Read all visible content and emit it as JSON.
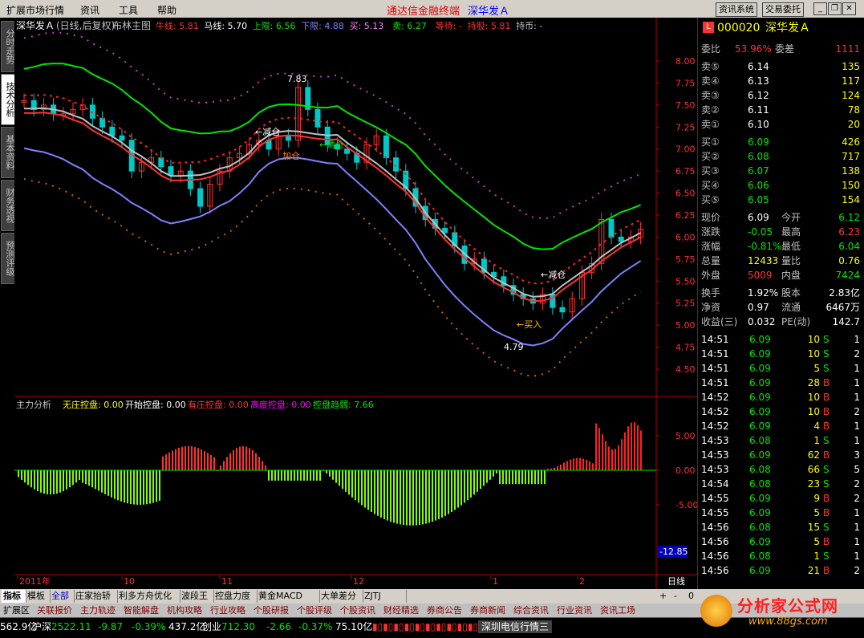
{
  "menu": {
    "items": [
      "扩展市场行情",
      "资讯",
      "工具",
      "帮助"
    ],
    "brand": "通达信金融终端",
    "brand_stock": "深华发Ａ",
    "buttons": [
      "资讯系统",
      "交易委托"
    ]
  },
  "left_tabs": [
    "分时走势",
    "技术分析",
    "基本资料",
    "财务透视",
    "预测评级"
  ],
  "main_chart": {
    "header_name": "深华发Ａ",
    "header_mode": "(日线,后复权)",
    "indicator": "布林主图",
    "labels": [
      {
        "t": "牛线: 5.81",
        "c": "#ff3232"
      },
      {
        "t": "马线: 5.70",
        "c": "#ffffff"
      },
      {
        "t": "上限: 6.56",
        "c": "#00e600"
      },
      {
        "t": "下限: 4.88",
        "c": "#8080ff"
      },
      {
        "t": "买: 5.13",
        "c": "#ff80ff"
      },
      {
        "t": "卖: 6.27",
        "c": "#00e600"
      },
      {
        "t": "等待: -",
        "c": "#ff3232"
      },
      {
        "t": "持股: 5.81",
        "c": "#ff3232"
      },
      {
        "t": "持币: -",
        "c": "#c0c0c0"
      }
    ],
    "price_ticks": [
      "8.00",
      "7.75",
      "7.50",
      "7.25",
      "7.00",
      "6.75",
      "6.50",
      "6.25",
      "6.00",
      "5.75",
      "5.50",
      "5.25",
      "5.00",
      "4.75",
      "4.50"
    ],
    "annotations": [
      {
        "t": "7.83",
        "c": "#ffffff"
      },
      {
        "t": "←减仓",
        "c": "#ffffff"
      },
      {
        "t": "加仓",
        "c": "#ff8000"
      },
      {
        "t": "←清仓",
        "c": "#00e600"
      },
      {
        "t": "←减仓",
        "c": "#ffffff"
      },
      {
        "t": "←买入",
        "c": "#ffc000"
      },
      {
        "t": "4.79",
        "c": "#ffffff"
      }
    ]
  },
  "sub_chart": {
    "indicator": "主力分析",
    "labels": [
      {
        "t": "无庄控盘: 0.00",
        "c": "#ffff00"
      },
      {
        "t": "开始控盘: 0.00",
        "c": "#ffffff"
      },
      {
        "t": "有庄控盘: 0.00",
        "c": "#ff3232"
      },
      {
        "t": "高度控盘: 0.00",
        "c": "#ff00ff"
      },
      {
        "t": "控盘趋弱: 7.66",
        "c": "#00e600"
      }
    ],
    "ticks": [
      "5.00",
      "0.00",
      "-5.00"
    ],
    "cursor_value": "-12.85"
  },
  "time_axis": {
    "labels": [
      "2011年",
      "10",
      "11",
      "12",
      "1",
      "2"
    ],
    "period": "日线"
  },
  "quote": {
    "code": "000020",
    "name": "深华发Ａ",
    "weibi_label": "委比",
    "weibi": "53.96%",
    "weicha_label": "委差",
    "weicha": "1111",
    "asks": [
      [
        "卖⑤",
        "6.14",
        "135"
      ],
      [
        "卖④",
        "6.13",
        "117"
      ],
      [
        "卖③",
        "6.12",
        "124"
      ],
      [
        "卖②",
        "6.11",
        "78"
      ],
      [
        "卖①",
        "6.10",
        "20"
      ]
    ],
    "bids": [
      [
        "买①",
        "6.09",
        "426"
      ],
      [
        "买②",
        "6.08",
        "717"
      ],
      [
        "买③",
        "6.07",
        "138"
      ],
      [
        "买④",
        "6.06",
        "150"
      ],
      [
        "买⑤",
        "6.05",
        "154"
      ]
    ],
    "stats": [
      [
        "现价",
        "6.09",
        "今开",
        "6.12"
      ],
      [
        "涨跌",
        "-0.05",
        "最高",
        "6.23"
      ],
      [
        "涨幅",
        "-0.81%",
        "最低",
        "6.04"
      ],
      [
        "总量",
        "12433",
        "量比",
        "0.76"
      ],
      [
        "外盘",
        "5009",
        "内盘",
        "7424"
      ]
    ],
    "stats2": [
      [
        "换手",
        "1.92%",
        "股本",
        "2.83亿"
      ],
      [
        "净资",
        "0.97",
        "流通",
        "6467万"
      ],
      [
        "收益(三)",
        "0.032",
        "PE(动)",
        "142.7"
      ]
    ],
    "ticks": [
      [
        "14:51",
        "6.09",
        "10",
        "S",
        "1"
      ],
      [
        "14:51",
        "6.09",
        "10",
        "S",
        "2"
      ],
      [
        "14:51",
        "6.09",
        "5",
        "S",
        "1"
      ],
      [
        "14:51",
        "6.09",
        "28",
        "B",
        "1"
      ],
      [
        "14:52",
        "6.09",
        "10",
        "B",
        "1"
      ],
      [
        "14:52",
        "6.09",
        "10",
        "B",
        "2"
      ],
      [
        "14:52",
        "6.09",
        "4",
        "B",
        "1"
      ],
      [
        "14:53",
        "6.08",
        "1",
        "S",
        "1"
      ],
      [
        "14:53",
        "6.09",
        "62",
        "B",
        "3"
      ],
      [
        "14:53",
        "6.08",
        "66",
        "S",
        "5"
      ],
      [
        "14:54",
        "6.08",
        "23",
        "S",
        "2"
      ],
      [
        "14:55",
        "6.09",
        "9",
        "B",
        "2"
      ],
      [
        "14:55",
        "6.09",
        "5",
        "B",
        "1"
      ],
      [
        "14:56",
        "6.08",
        "15",
        "S",
        "1"
      ],
      [
        "14:56",
        "6.09",
        "5",
        "B",
        "1"
      ],
      [
        "14:56",
        "6.08",
        "1",
        "S",
        "1"
      ],
      [
        "14:56",
        "6.09",
        "21",
        "B",
        "2"
      ]
    ]
  },
  "tabs1": [
    "扩展区",
    "关联报价",
    "主力轨迹",
    "智能解盘",
    "机构攻略",
    "行业攻略",
    "个股研报",
    "个股评级",
    "个股资讯",
    "财经精选",
    "券商公告",
    "券商新闻",
    "综合资讯",
    "行业资讯",
    "资讯工场"
  ],
  "tabs2": [
    "指标",
    "模板",
    "全部",
    "庄家抬轿",
    "利多方舟优化",
    "波段王",
    "控盘力度",
    "黄金MACD",
    "大单差分",
    "ZJTJ"
  ],
  "status": {
    "lead": "562.9亿",
    "sz_label": "沪深",
    "sz_val": "2522.11",
    "sz_chg": "-9.87",
    "sz_pct": "-0.39%",
    "sz_amt": "437.2亿",
    "cy_label": "创业",
    "cy_val": "712.30",
    "cy_chg": "-2.66",
    "cy_pct": "-0.37%",
    "cy_amt": "75.10亿",
    "server": "深圳电信行情三"
  },
  "logo": {
    "text": "分析家公式网",
    "url": "www.88gs.com"
  }
}
